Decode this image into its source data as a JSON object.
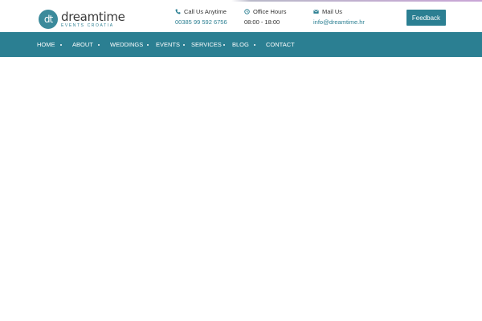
{
  "brand": {
    "logo_mark": "dt",
    "name": "dreamtime",
    "tagline": "EVENTS CROATIA"
  },
  "contacts": {
    "phone": {
      "label": "Call Us Anytime",
      "value": "00385 99 592 6756",
      "icon": "phone-icon"
    },
    "hours": {
      "label": "Office Hours",
      "value": "08:00 - 18:00",
      "icon": "clock-icon"
    },
    "mail": {
      "label": "Mail Us",
      "value": "info@dreamtime.hr",
      "icon": "envelope-icon"
    }
  },
  "feedback_label": "Feedback",
  "nav": {
    "items": [
      "HOME",
      "ABOUT",
      "WEDDINGS",
      "EVENTS",
      "SERVICES",
      "BLOG",
      "CONTACT"
    ]
  },
  "colors": {
    "accent": "#2b7f92",
    "text": "#333333",
    "background": "#ffffff"
  }
}
